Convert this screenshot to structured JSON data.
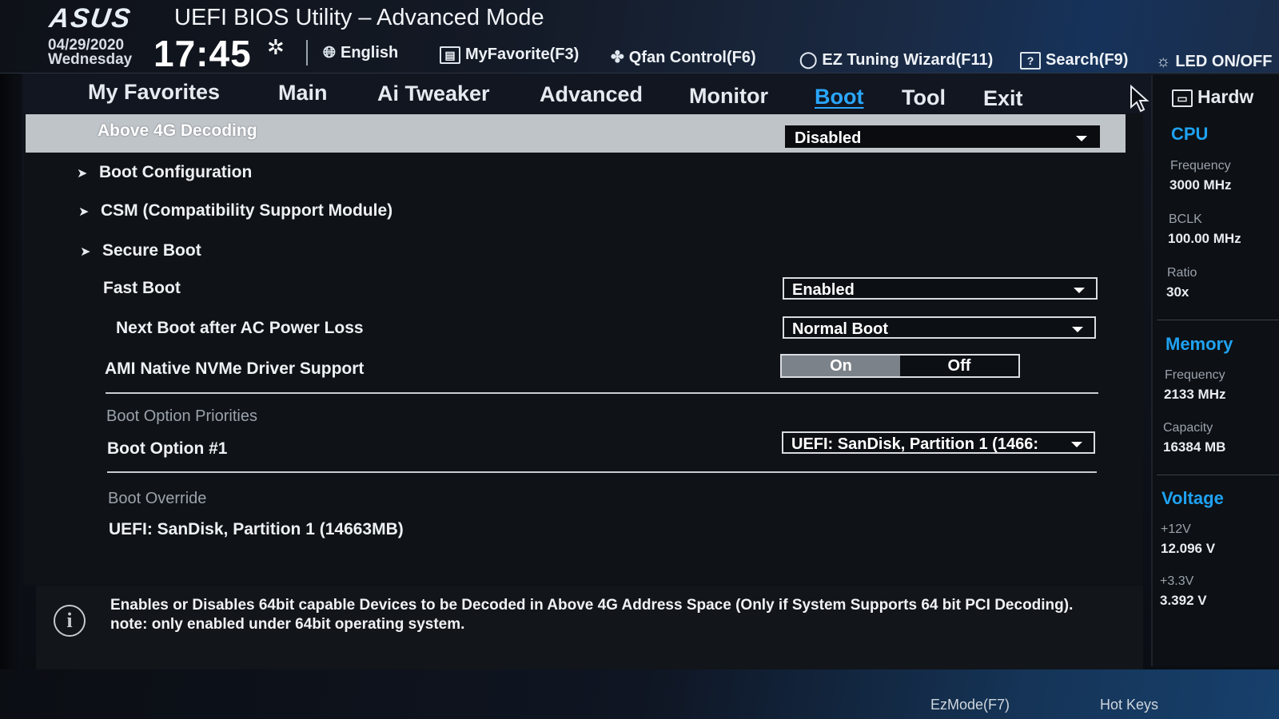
{
  "header": {
    "logo": "ASUS",
    "title": "UEFI BIOS Utility – Advanced Mode",
    "date": "04/29/2020",
    "day": "Wednesday",
    "time": "17:45",
    "language": "English",
    "myfavorite": "MyFavorite(F3)",
    "qfan": "Qfan Control(F6)",
    "ez_tuning": "EZ Tuning Wizard(F11)",
    "search": "Search(F9)",
    "led": "LED ON/OFF"
  },
  "tabs": [
    "My Favorites",
    "Main",
    "Ai Tweaker",
    "Advanced",
    "Monitor",
    "Boot",
    "Tool",
    "Exit"
  ],
  "active_tab": "Boot",
  "boot": {
    "above4g": {
      "label": "Above 4G Decoding",
      "value": "Disabled"
    },
    "boot_configuration": "Boot Configuration",
    "csm": "CSM (Compatibility Support Module)",
    "secure_boot": "Secure Boot",
    "fast_boot": {
      "label": "Fast Boot",
      "value": "Enabled"
    },
    "next_boot": {
      "label": "Next Boot after AC Power Loss",
      "value": "Normal Boot"
    },
    "nvme": {
      "label": "AMI Native NVMe Driver Support",
      "on": "On",
      "off": "Off",
      "selected": "On"
    },
    "boot_option_priorities": "Boot Option Priorities",
    "boot_option_1": {
      "label": "Boot Option #1",
      "value": "UEFI: SanDisk, Partition 1 (1466:"
    },
    "boot_override": "Boot Override",
    "override_item": "UEFI: SanDisk, Partition 1 (14663MB)"
  },
  "help": {
    "line1": "Enables or Disables 64bit capable Devices to be Decoded in Above 4G Address Space (Only if System Supports 64 bit PCI Decoding).",
    "line2": "note: only enabled under 64bit operating system."
  },
  "hardware_monitor": {
    "title": "Hardw",
    "cpu": {
      "heading": "CPU",
      "frequency_label": "Frequency",
      "frequency": "3000 MHz",
      "bclk_label": "BCLK",
      "bclk": "100.00 MHz",
      "ratio_label": "Ratio",
      "ratio": "30x"
    },
    "memory": {
      "heading": "Memory",
      "frequency_label": "Frequency",
      "frequency": "2133 MHz",
      "capacity_label": "Capacity",
      "capacity": "16384 MB"
    },
    "voltage": {
      "heading": "Voltage",
      "v12_label": "+12V",
      "v12": "12.096 V",
      "v33_label": "+3.3V",
      "v33": "3.392 V"
    }
  },
  "footer": {
    "ezmode": "EzMode(F7)",
    "hotkeys": "Hot Keys"
  },
  "colors": {
    "accent": "#1fa2f2",
    "highlight_row": "#bfc4c9",
    "toggle_on": "#7b8289"
  }
}
